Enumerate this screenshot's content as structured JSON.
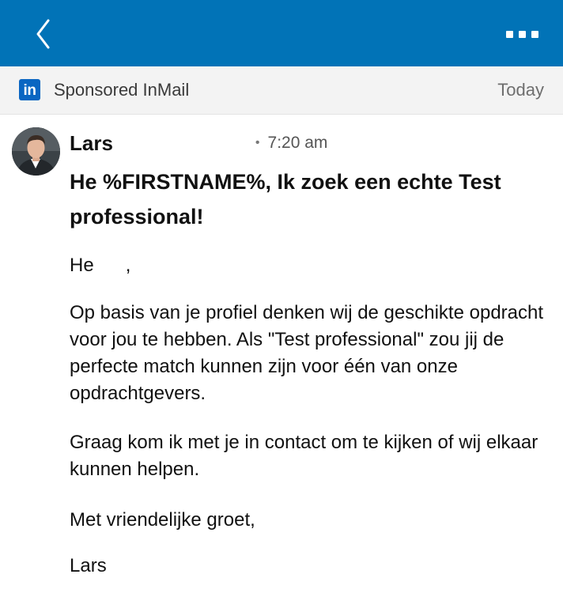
{
  "topbar": {
    "background_color": "#0173b7",
    "back_icon": "chevron-left-icon",
    "more_icon": "more-horizontal-icon"
  },
  "subbar": {
    "logo_text": "in",
    "logo_color": "#0a66c2",
    "title": "Sponsored InMail",
    "date": "Today"
  },
  "message": {
    "sender_first_name": "Lars",
    "time_separator": "•",
    "time": "7:20 am",
    "subject": "He %FIRSTNAME%, Ik zoek een echte Test professional!",
    "greeting_word": "He",
    "greeting_punct": ",",
    "paragraphs": [
      "Op basis van je profiel denken wij de geschikte opdracht voor jou te hebben. Als \"Test professional\" zou jij de perfecte match kunnen zijn voor één van onze opdrachtgevers.",
      "Graag kom ik met je in contact om te kijken of wij elkaar kunnen helpen."
    ],
    "closing": "Met vriendelijke groet,",
    "signature": "Lars"
  }
}
